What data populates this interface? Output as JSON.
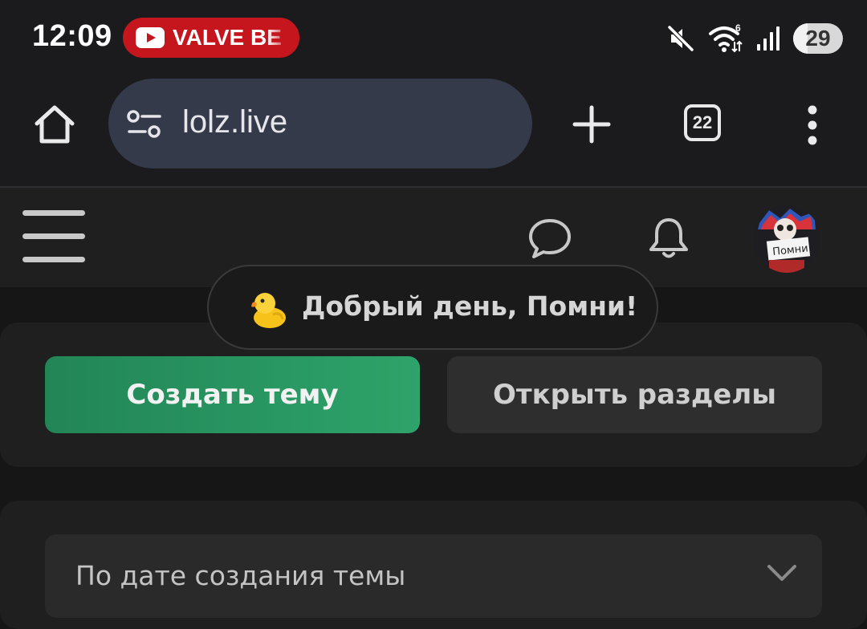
{
  "status_bar": {
    "time": "12:09",
    "notification_pill": "VALVE BE",
    "battery_level": "29",
    "icons": [
      "youtube-icon",
      "mute-icon",
      "wifi-6-icon",
      "signal-icon",
      "battery-icon"
    ]
  },
  "browser": {
    "url": "lolz.live",
    "tab_count": "22",
    "icons": [
      "home-icon",
      "site-settings-icon",
      "plus-icon",
      "tab-switcher-icon",
      "more-vert-icon"
    ]
  },
  "site_header": {
    "icons": [
      "hamburger-menu-icon",
      "chat-bubble-icon",
      "bell-icon"
    ],
    "avatar_text": "Помни"
  },
  "toast": {
    "emoji": "duck-icon",
    "message": "Добрый день, Помни!"
  },
  "actions": {
    "create_topic": "Создать тему",
    "open_sections": "Открыть разделы"
  },
  "sort": {
    "selected": "По дате создания темы"
  },
  "colors": {
    "background": "#161616",
    "card": "#1f1f1f",
    "primary_green": "#2a9a62",
    "url_bar": "#343a4a",
    "notification_red": "#c4161c"
  }
}
